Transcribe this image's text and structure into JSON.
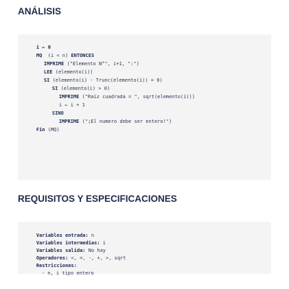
{
  "section1": {
    "title": "ANÁLISIS",
    "lines": [
      {
        "a": "i ← 0"
      },
      {
        "a": "MQ",
        "b": "  (i < n) ",
        "c": "ENTONCES"
      },
      {
        "a": "IMPRIME",
        "b": " (\"Elemento N°\", i+1, \":\")"
      },
      {
        "a": "LEE",
        "b": " (elemento(i))"
      },
      {
        "a": "SI",
        "b": " (elemento(i) - Trunc(elemento(i)) = 0)"
      },
      {
        "a": "SI",
        "b": " (elemento(i) > 0)"
      },
      {
        "a": "IMPRIME",
        "b": " (\"Raíz cuadrada = \", sqrt(elemento(i)))"
      },
      {
        "a": "i ← i + 1"
      },
      {
        "a": "SINO"
      },
      {
        "a": "IMPRIME",
        "b": " (\"¡El numero debe ser entero!\")"
      },
      {
        "a": "Fin",
        "b": " (MQ)"
      }
    ]
  },
  "section2": {
    "title": "REQUISITOS Y ESPECIFICACIONES",
    "lines": [
      {
        "a": "Variables entrada:",
        "b": " n"
      },
      {
        "a": "Variables intermedias:",
        "b": " i"
      },
      {
        "a": "Variables salida:",
        "b": " No hay"
      },
      {
        "a": "Operadores:",
        "b": " <, =, -, +, >, sqrt"
      },
      {
        "a": "Restricciones:"
      },
      {
        "a": "- n, i tipo entero"
      }
    ]
  }
}
